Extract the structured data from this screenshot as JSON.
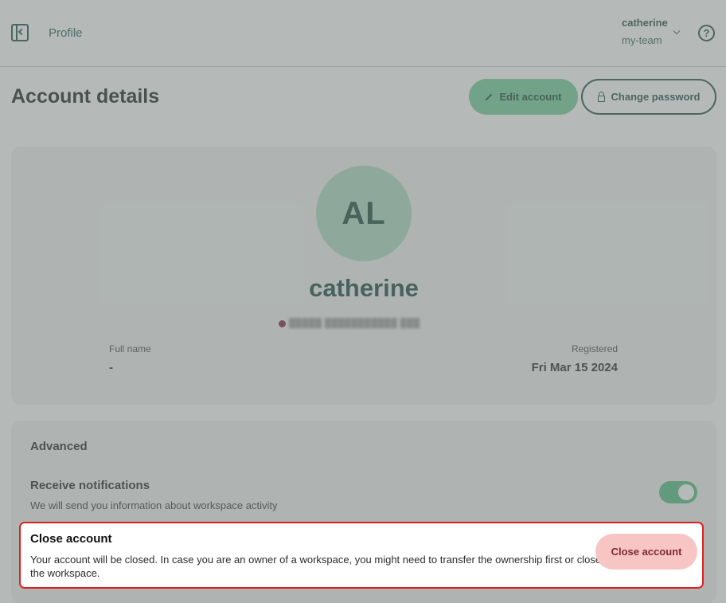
{
  "topbar": {
    "page_title": "Profile",
    "user_name": "catherine",
    "team_name": "my-team",
    "help_glyph": "?"
  },
  "header": {
    "title": "Account details",
    "edit_label": "Edit account",
    "change_password_label": "Change password"
  },
  "profile": {
    "initials": "AL",
    "display_name": "catherine",
    "email_obscured": "█████ ███████████ ███",
    "full_name_label": "Full name",
    "full_name_value": "-",
    "registered_label": "Registered",
    "registered_value": "Fri Mar 15 2024"
  },
  "advanced": {
    "title": "Advanced",
    "notifications_title": "Receive notifications",
    "notifications_desc": "We will send you information about workspace activity",
    "notifications_enabled": true,
    "close_title": "Close account",
    "close_desc": "Your account will be closed. In case you are an owner of a workspace, you might need to transfer the ownership first or close the workspace.",
    "close_button_label": "Close account"
  },
  "colors": {
    "accent_green": "#6ccb94",
    "dark_green": "#14433b",
    "danger_border": "#e02020",
    "danger_button_bg": "#f8c5c5"
  }
}
